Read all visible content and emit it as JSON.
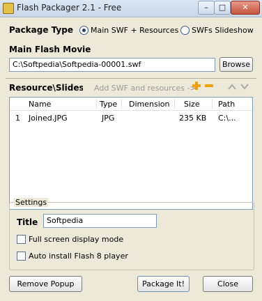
{
  "window": {
    "title": "Flash Packager 2.1 - Free"
  },
  "package_type": {
    "label": "Package Type",
    "options": [
      {
        "label": "Main SWF + Resources",
        "selected": true
      },
      {
        "label": "SWFs Slideshow",
        "selected": false
      }
    ]
  },
  "main_movie": {
    "label": "Main Flash Movie",
    "path": "C:\\Softpedia\\Softpedia-00001.swf",
    "browse_label": "Browse"
  },
  "resources": {
    "label": "Resource\\Slidesho",
    "hint": "Add SWF and resources ->",
    "columns": [
      "Name",
      "Type",
      "Dimension",
      "Size",
      "Path"
    ],
    "rows": [
      {
        "index": "1",
        "name": "Joined.JPG",
        "type": "JPG",
        "dimension": "",
        "size": "235 KB",
        "path": "C:\\..."
      }
    ]
  },
  "settings": {
    "group_label": "Settings",
    "title_label": "Title",
    "title_value": "Softpedia",
    "fullscreen_label": "Full screen display mode",
    "autoinstall_label": "Auto install Flash 8 player"
  },
  "buttons": {
    "remove_popup": "Remove Popup",
    "package_it": "Package It!",
    "close": "Close"
  },
  "colors": {
    "accent_orange": "#f0a000",
    "window_bg": "#ece9d8"
  }
}
